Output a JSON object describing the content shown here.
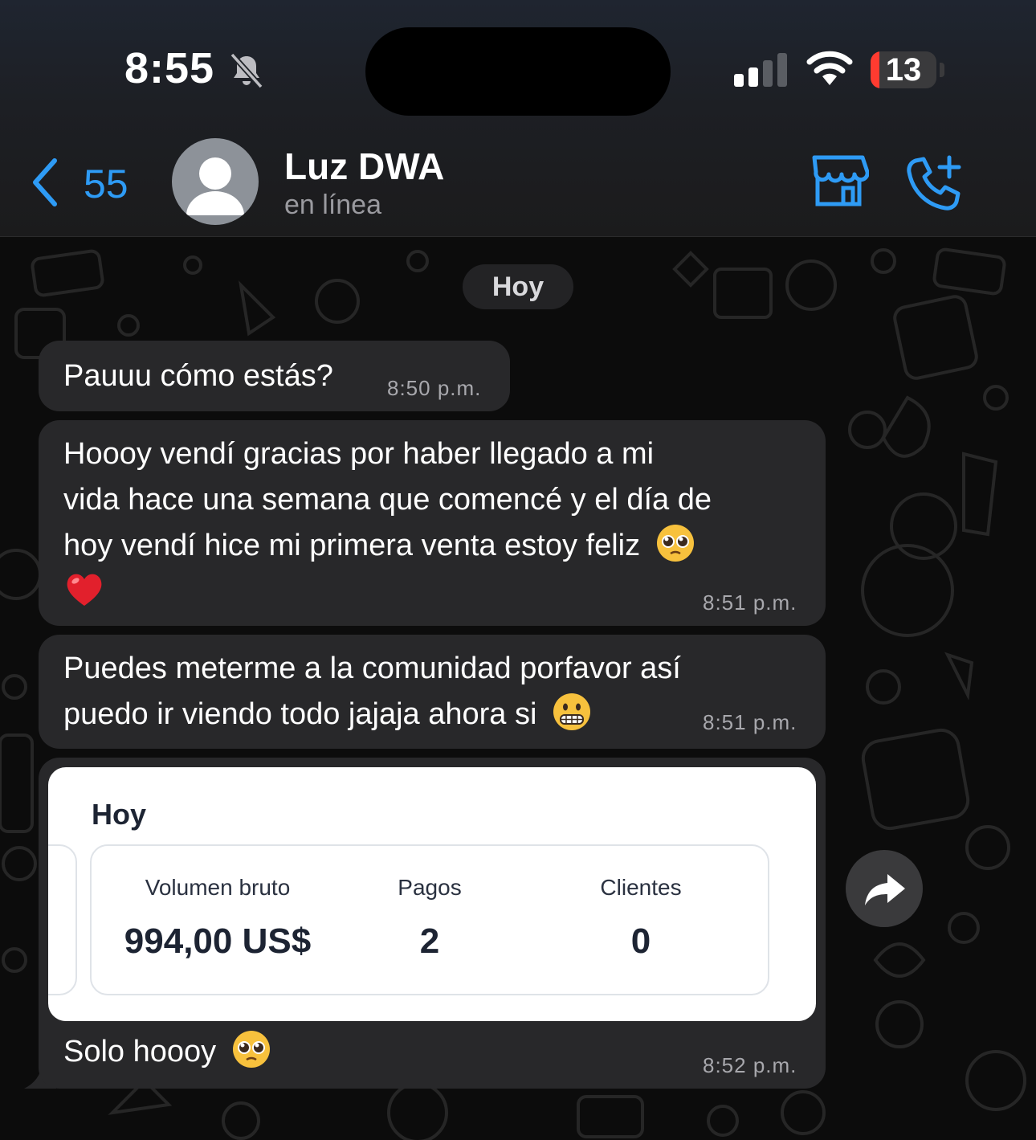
{
  "status_bar": {
    "time": "8:55",
    "battery": "13",
    "battery_level": 0.13
  },
  "header": {
    "back_count": "55",
    "contact_name": "Luz DWA",
    "contact_status": "en línea"
  },
  "chat": {
    "date_chip": "Hoy",
    "messages": [
      {
        "text": "Pauuu cómo estás?",
        "time": "8:50 p.m."
      },
      {
        "lines": [
          "Hoooy vendí gracias por haber llegado a mi",
          "vida hace una semana que comencé y el día de",
          "hoy vendí hice mi primera venta estoy feliz"
        ],
        "time": "8:51 p.m."
      },
      {
        "lines": [
          "Puedes meterme a la comunidad porfavor así",
          "puedo ir viendo todo jajaja ahora si"
        ],
        "time": "8:51 p.m."
      },
      {
        "caption": "Solo hoooy",
        "time": "8:52 p.m."
      }
    ],
    "card": {
      "title": "Hoy",
      "metrics": [
        {
          "label": "Volumen bruto",
          "value": "994,00 US$"
        },
        {
          "label": "Pagos",
          "value": "2"
        },
        {
          "label": "Clientes",
          "value": "0"
        }
      ]
    }
  }
}
